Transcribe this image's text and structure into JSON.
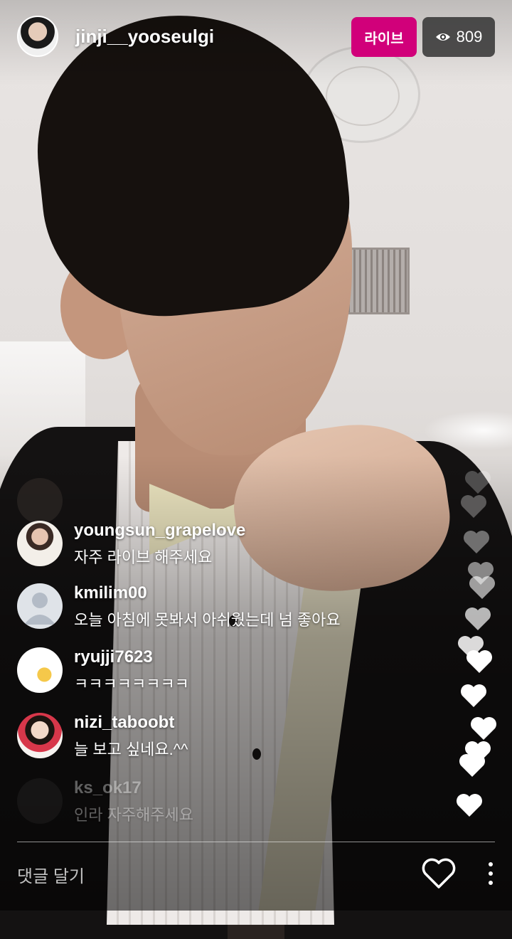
{
  "header": {
    "username": "jinji__yooseulgi",
    "live_label": "라이브",
    "viewer_count": "809",
    "viewer_icon": "eye-icon"
  },
  "comments": [
    {
      "username": "",
      "text": "",
      "faded": true
    },
    {
      "username": "youngsun_grapelove",
      "text": "자주 라이브 해주세요"
    },
    {
      "username": "kmilim00",
      "text": "오늘 아침에 못봐서 아쉬웠는데 넘 좋아요"
    },
    {
      "username": "ryujji7623",
      "text": "ㅋㅋㅋㅋㅋㅋㅋㅋ"
    },
    {
      "username": "nizi_taboobt",
      "text": "늘 보고 싶네요.^^"
    },
    {
      "username": "ks_ok17",
      "text": "인라 자주해주세요",
      "faded": true
    }
  ],
  "footer": {
    "comment_placeholder": "댓글 달기",
    "like_icon": "heart-outline-icon",
    "more_icon": "more-vertical-icon"
  },
  "colors": {
    "live_badge": "#d1007a",
    "viewer_badge": "#323232"
  }
}
